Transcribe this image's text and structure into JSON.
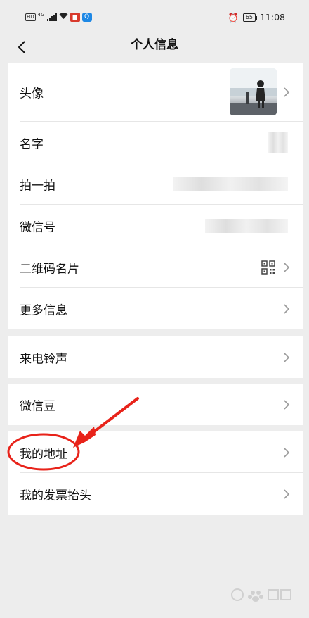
{
  "status_bar": {
    "net_tag": "HD",
    "signal_type": "4G",
    "battery": "65",
    "time": "11:08"
  },
  "header": {
    "title": "个人信息"
  },
  "profile_rows": [
    {
      "label": "头像"
    },
    {
      "label": "名字"
    },
    {
      "label": "拍一拍"
    },
    {
      "label": "微信号"
    },
    {
      "label": "二维码名片"
    },
    {
      "label": "更多信息"
    }
  ],
  "ringtone": {
    "label": "来电铃声"
  },
  "beans": {
    "label": "微信豆"
  },
  "address": {
    "label": "我的地址"
  },
  "invoice": {
    "label": "我的发票抬头"
  },
  "annotation_color": "#e8231a"
}
